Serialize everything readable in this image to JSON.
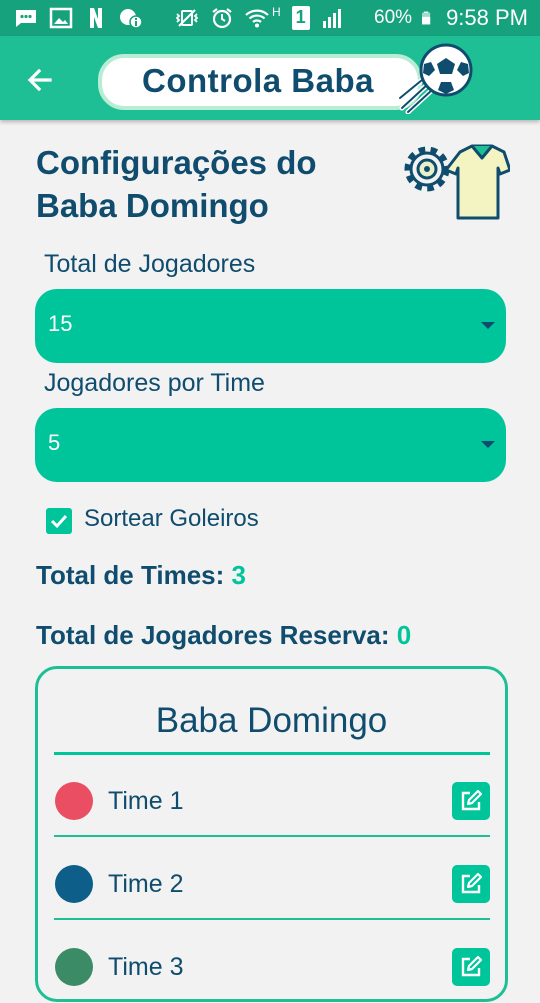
{
  "status_bar": {
    "battery": "60%",
    "time": "9:58 PM",
    "network_type": "H",
    "sim_slot": "1"
  },
  "app_bar": {
    "title": "Controla Baba"
  },
  "page": {
    "title": "Configurações do\nBaba Domingo"
  },
  "form": {
    "total_players": {
      "label": "Total de Jogadores",
      "value": "15"
    },
    "players_per_team": {
      "label": "Jogadores por Time",
      "value": "5"
    },
    "draw_goalkeepers": {
      "label": "Sortear Goleiros",
      "checked": true
    }
  },
  "stats": {
    "total_teams_label": "Total de Times:",
    "total_teams_value": "3",
    "reserve_label": "Total de Jogadores Reserva:",
    "reserve_value": "0"
  },
  "teams_card": {
    "title": "Baba Domingo",
    "teams": [
      {
        "name": "Time 1",
        "color": "#e94e62"
      },
      {
        "name": "Time 2",
        "color": "#0d5f8a"
      },
      {
        "name": "Time 3",
        "color": "#3b8b66"
      }
    ]
  },
  "colors": {
    "status_bar": "#17a27e",
    "app_bar": "#1ebf95",
    "accent": "#00c49a",
    "text_primary": "#0f4c6e",
    "background": "#f2f2f2"
  }
}
